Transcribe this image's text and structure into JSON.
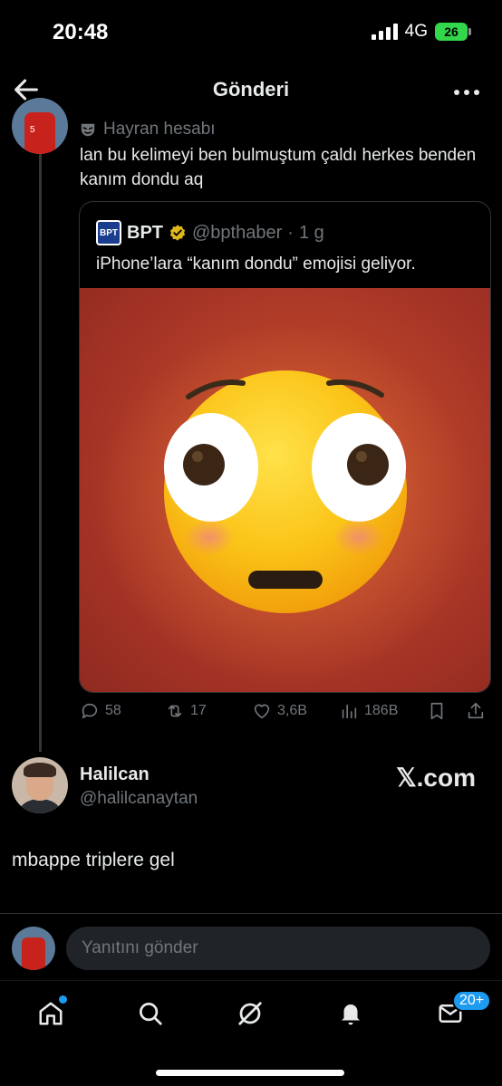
{
  "status_bar": {
    "time": "20:48",
    "network": "4G",
    "battery": "26"
  },
  "header": {
    "title": "Gönderi"
  },
  "tweet": {
    "fan_label": "Hayran hesabı",
    "text": "lan bu kelimeyi ben bulmuştum çaldı herkes benden kanım dondu aq",
    "quote": {
      "logo_text": "BPT",
      "name": "BPT",
      "handle": "@bpthaber",
      "separator": "·",
      "age": "1 g",
      "text": "iPhone’lara “kanım dondu” emojisi geliyor."
    },
    "actions": {
      "replies": "58",
      "retweets": "17",
      "likes": "3,6B",
      "views": "186B"
    }
  },
  "reply_post": {
    "name": "Halilcan",
    "handle": "@halilcanaytan",
    "watermark": "𝕏.com",
    "text": "mbappe triplere gel"
  },
  "reply_bar": {
    "placeholder": "Yanıtını gönder"
  },
  "tab_bar": {
    "messages_badge": "20+"
  },
  "colors": {
    "accent": "#1d9bf0",
    "verified_gold": "#e2b719",
    "background": "#000000",
    "muted": "#71767b"
  }
}
